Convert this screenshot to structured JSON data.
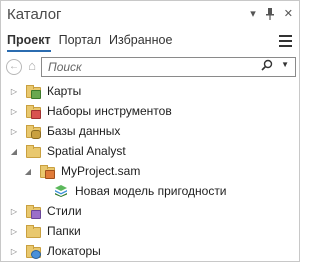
{
  "title": "Каталог",
  "title_icons": [
    "dropdown-arrow-icon",
    "pin-icon",
    "close-icon"
  ],
  "tabs": [
    {
      "label": "Проект",
      "active": true
    },
    {
      "label": "Портал",
      "active": false
    },
    {
      "label": "Избранное",
      "active": false
    }
  ],
  "search": {
    "placeholder": "Поиск"
  },
  "tree": [
    {
      "label": "Карты",
      "icon": "maps-folder-icon",
      "expanded": false,
      "level": 0
    },
    {
      "label": "Наборы инструментов",
      "icon": "toolboxes-folder-icon",
      "expanded": false,
      "level": 0
    },
    {
      "label": "Базы данных",
      "icon": "databases-folder-icon",
      "expanded": false,
      "level": 0
    },
    {
      "label": "Spatial Analyst",
      "icon": "folder-icon",
      "expanded": true,
      "level": 0
    },
    {
      "label": "MyProject.sam",
      "icon": "suitability-project-icon",
      "expanded": true,
      "level": 1
    },
    {
      "label": "Новая модель пригодности",
      "icon": "suitability-model-icon",
      "expanded": null,
      "level": 2
    },
    {
      "label": "Стили",
      "icon": "styles-folder-icon",
      "expanded": false,
      "level": 0
    },
    {
      "label": "Папки",
      "icon": "folders-icon",
      "expanded": false,
      "level": 0
    },
    {
      "label": "Локаторы",
      "icon": "locators-folder-icon",
      "expanded": false,
      "level": 0
    }
  ],
  "colors": {
    "accent": "#2b6cb0",
    "folder": "#e9c86e"
  }
}
